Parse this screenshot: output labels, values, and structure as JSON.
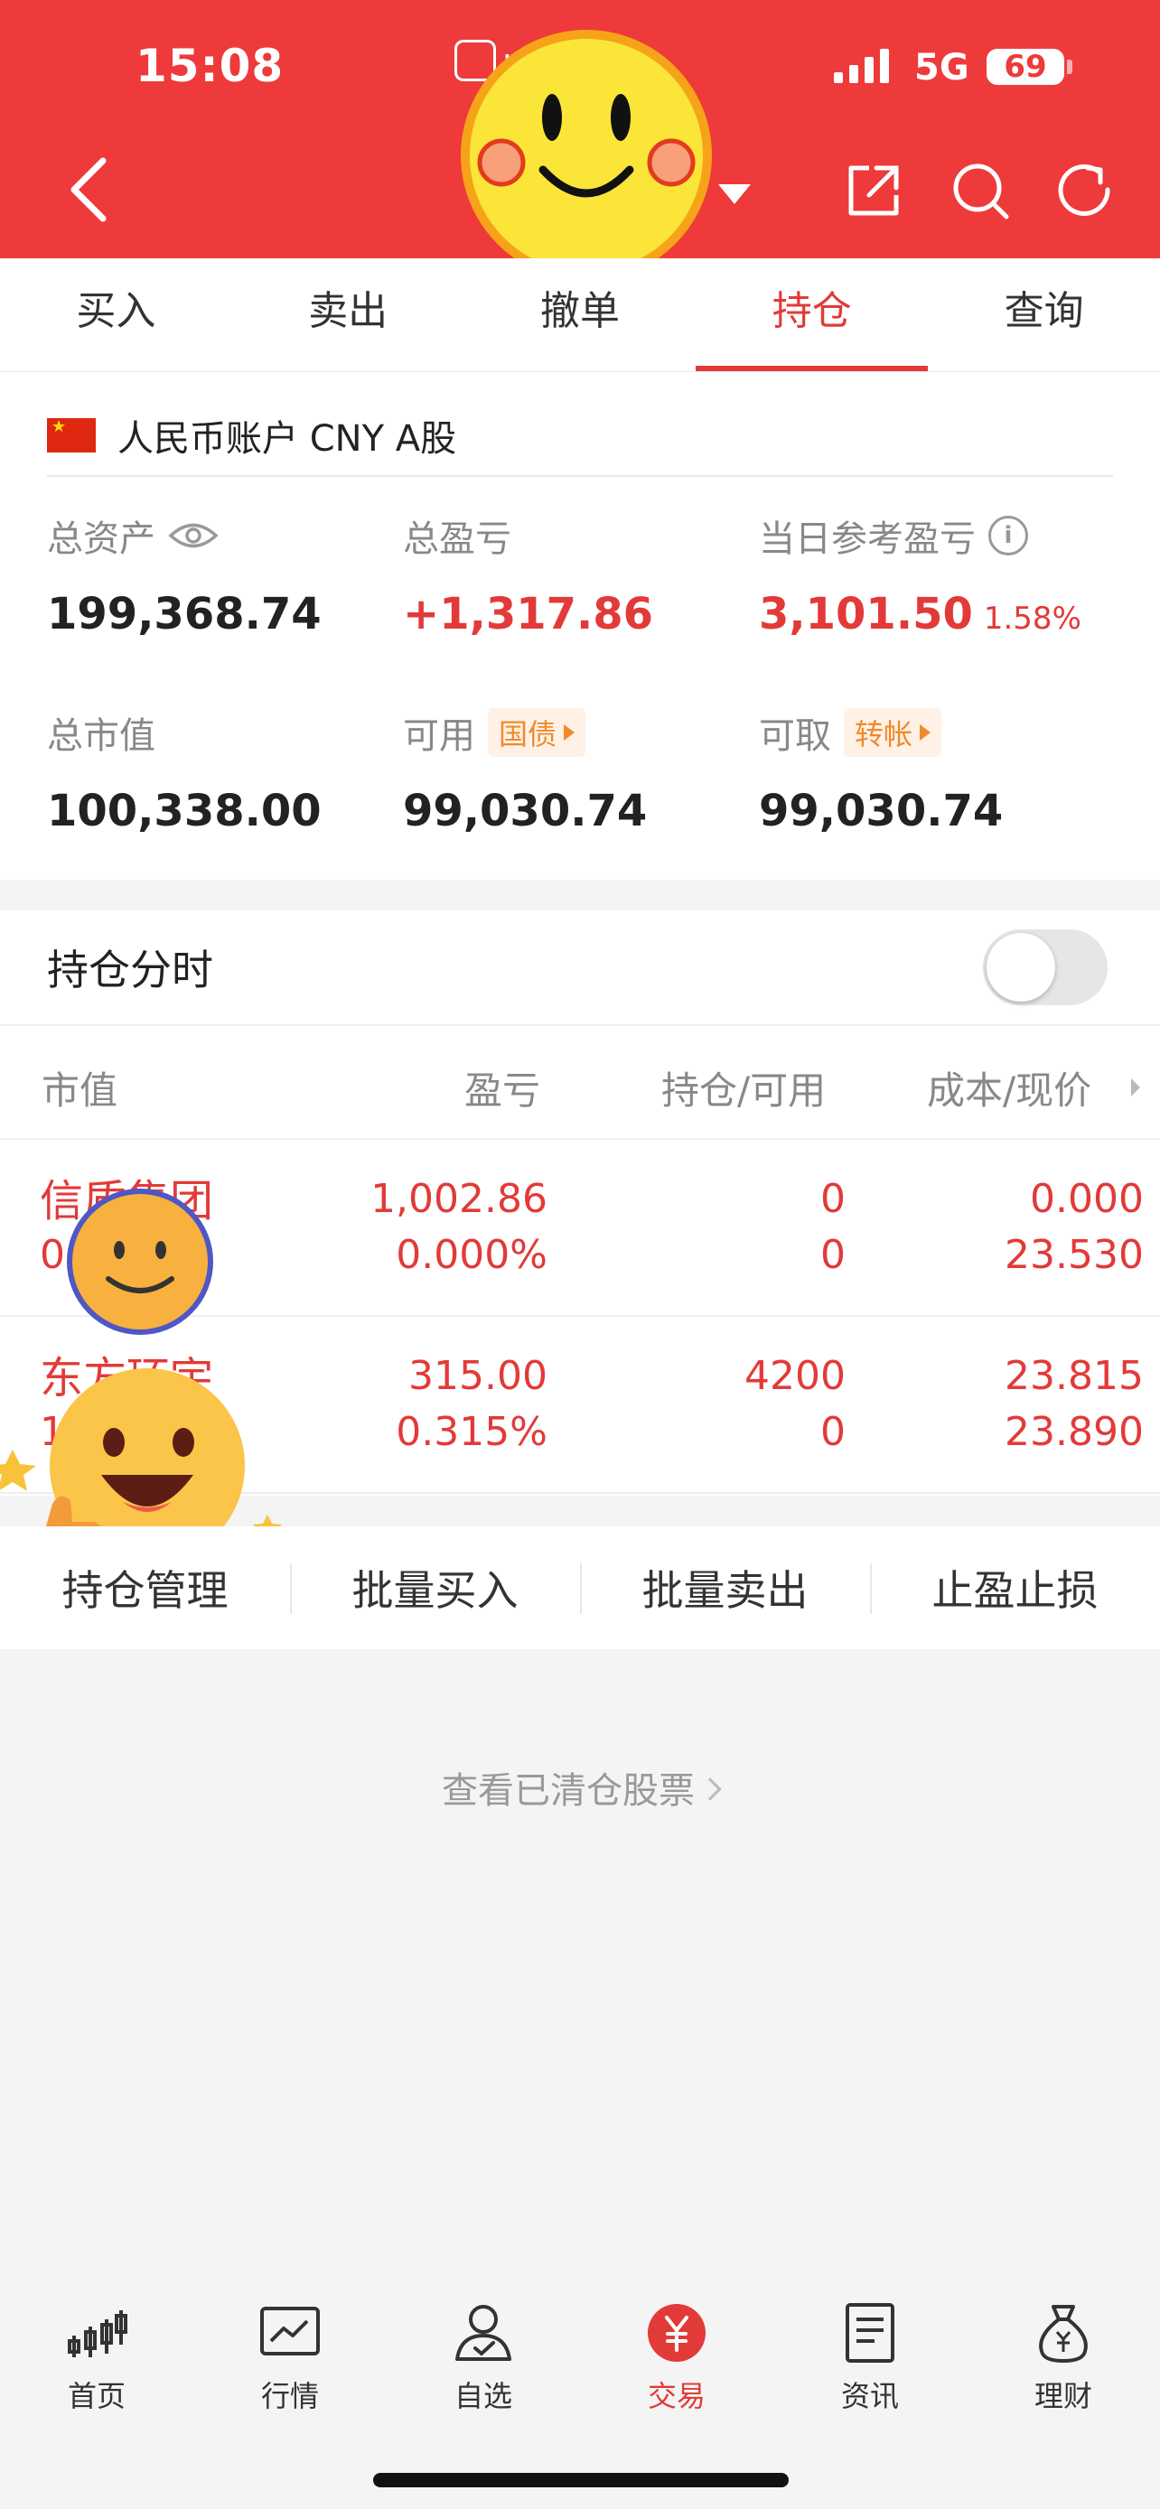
{
  "status_bar": {
    "time": "15:08",
    "app_fragment": "pp",
    "network": "5G",
    "battery": "69"
  },
  "tabs": [
    {
      "label": "买入",
      "active": false
    },
    {
      "label": "卖出",
      "active": false
    },
    {
      "label": "撤单",
      "active": false
    },
    {
      "label": "持仓",
      "active": true
    },
    {
      "label": "查询",
      "active": false
    }
  ],
  "account": {
    "name": "人民币账户 CNY A股",
    "total_assets": {
      "label": "总资产",
      "value": "199,368.74"
    },
    "total_pnl": {
      "label": "总盈亏",
      "value": "+1,317.86"
    },
    "daily_pnl": {
      "label": "当日参考盈亏",
      "value": "3,101.50",
      "percent": "1.58%"
    },
    "market_value": {
      "label": "总市值",
      "value": "100,338.00"
    },
    "available": {
      "label": "可用",
      "tag": "国债",
      "value": "99,030.74"
    },
    "withdrawable": {
      "label": "可取",
      "tag": "转帐",
      "value": "99,030.74"
    }
  },
  "holdings": {
    "time_share_label": "持仓分时",
    "time_share_on": false,
    "columns": [
      "市值",
      "盈亏",
      "持仓/可用",
      "成本/现价"
    ],
    "rows": [
      {
        "name": "信质集团",
        "sub": "0",
        "pnl": "1,002.86",
        "pnl_pct": "0.000%",
        "position": "0",
        "available": "0",
        "cost": "0.000",
        "price": "23.530"
      },
      {
        "name": "东方环宇",
        "sub": "1",
        "pnl": "315.00",
        "pnl_pct": "0.315%",
        "position": "4200",
        "available": "0",
        "cost": "23.815",
        "price": "23.890"
      }
    ]
  },
  "actions": [
    "持仓管理",
    "批量买入",
    "批量卖出",
    "止盈止损"
  ],
  "cleared_link": "查看已清仓股票",
  "bottom_nav": [
    {
      "label": "首页",
      "icon": "candlestick-icon",
      "active": false
    },
    {
      "label": "行情",
      "icon": "market-chart-icon",
      "active": false
    },
    {
      "label": "自选",
      "icon": "user-check-icon",
      "active": false
    },
    {
      "label": "交易",
      "icon": "yuan-icon",
      "active": true
    },
    {
      "label": "资讯",
      "icon": "document-icon",
      "active": false
    },
    {
      "label": "理财",
      "icon": "money-bag-icon",
      "active": false
    }
  ],
  "colors": {
    "brand_red": "#ee3a3a",
    "gain_red": "#e23a38",
    "tag_orange": "#f08a2a"
  }
}
